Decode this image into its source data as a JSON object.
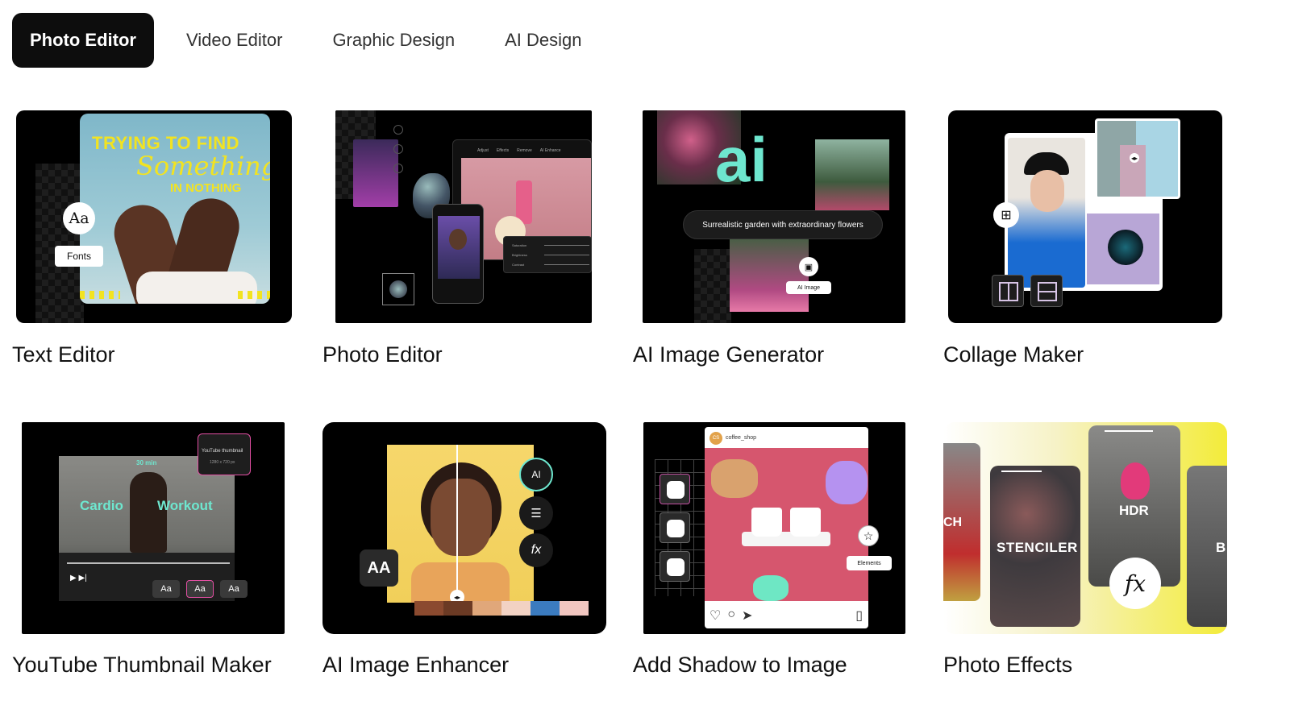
{
  "tabs": [
    {
      "label": "Photo Editor",
      "active": true
    },
    {
      "label": "Video Editor",
      "active": false
    },
    {
      "label": "Graphic Design",
      "active": false
    },
    {
      "label": "AI Design",
      "active": false
    }
  ],
  "cards": [
    {
      "title": "Text Editor",
      "poster_line1": "TRYING TO FIND",
      "poster_line2": "Something",
      "poster_line3": "IN NOTHING",
      "font_icon": "Aa",
      "font_chip": "Fonts"
    },
    {
      "title": "Photo Editor",
      "toolbar": [
        "Adjust",
        "Effects",
        "Remove",
        "AI Enhance"
      ],
      "sliders": [
        "Saturation",
        "Brightness",
        "Contrast"
      ]
    },
    {
      "title": "AI Image Generator",
      "logo_text": "ai",
      "prompt": "Surrealistic garden with extraordinary flowers",
      "chip": "AI Image"
    },
    {
      "title": "Collage Maker"
    },
    {
      "title": "YouTube Thumbnail Maker",
      "duration": "30 min",
      "word1": "Cardio",
      "word2": "Workout",
      "popup_title": "YouTube thumbnail",
      "popup_size": "1280 x 720 px",
      "font_buttons": [
        "Aa",
        "Aa",
        "Aa"
      ]
    },
    {
      "title": "AI Image Enhancer",
      "side_badge": "AA",
      "tools": [
        "AI",
        "adjust",
        "fx"
      ],
      "palette": [
        "#8b4a2f",
        "#6b3a24",
        "#e0a77a",
        "#f2d2c3",
        "#3b7bbf",
        "#f1c6c0"
      ]
    },
    {
      "title": "Add Shadow to Image",
      "account": "coffee_shop",
      "avatar_text": "CS",
      "chip": "Elements"
    },
    {
      "title": "Photo Effects",
      "effect_left": "CH",
      "effect1": "STENCILER",
      "effect2": "HDR",
      "effect_right": "B",
      "fx_label": "fx"
    }
  ],
  "colors": {
    "tab_active_bg": "#0d0d0d",
    "card_bg": "#000000",
    "ai_teal": "#6ee7cf",
    "accent_pink": "#e24fa3"
  }
}
